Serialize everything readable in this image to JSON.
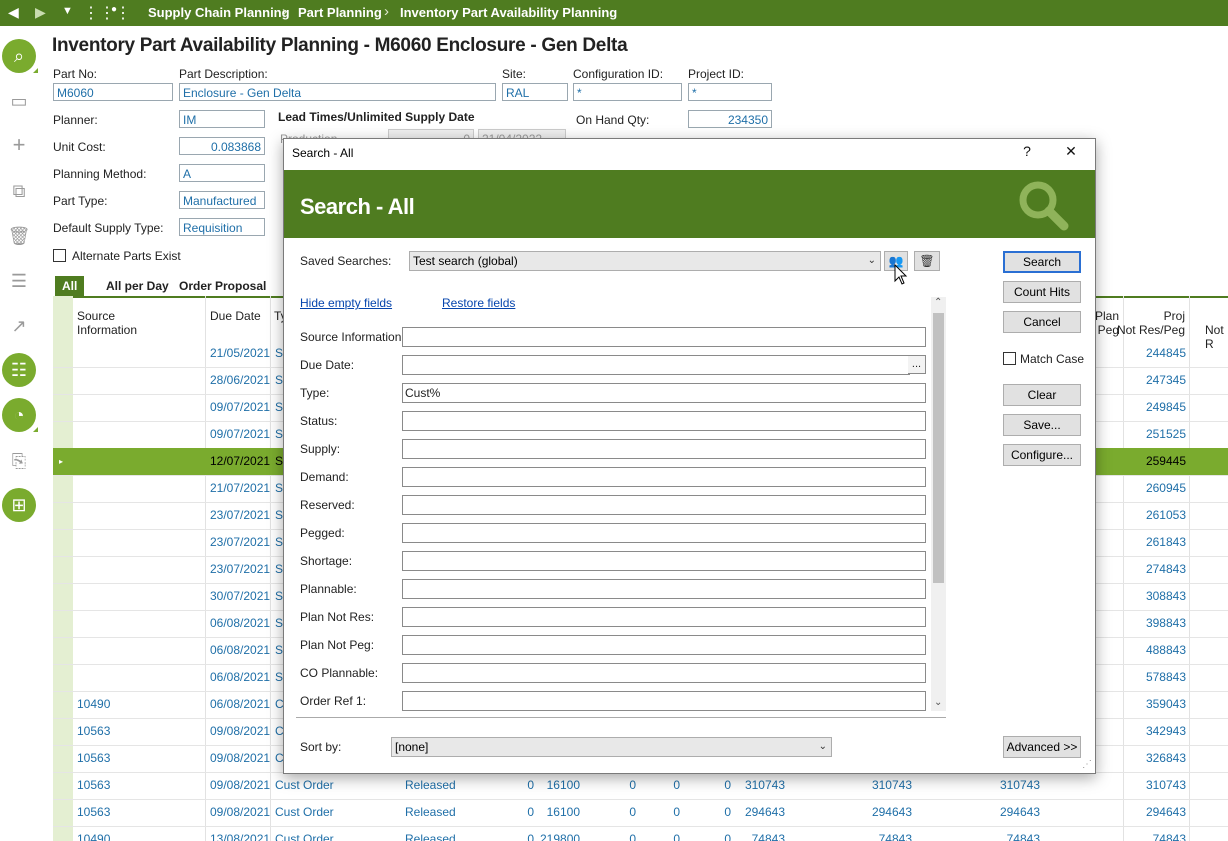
{
  "breadcrumb": {
    "items": [
      "Supply Chain Planning",
      "Part Planning",
      "Inventory Part Availability Planning"
    ]
  },
  "page": {
    "title": "Inventory Part Availability Planning - M6060 Enclosure - Gen Delta",
    "part_no_label": "Part No:",
    "part_no": "M6060",
    "part_desc_label": "Part Description:",
    "part_desc": "Enclosure - Gen Delta",
    "site_label": "Site:",
    "site": "RAL",
    "config_label": "Configuration ID:",
    "config": "*",
    "project_label": "Project ID:",
    "project": "*",
    "planner_label": "Planner:",
    "planner": "IM",
    "unit_cost_label": "Unit Cost:",
    "unit_cost": "0.083868",
    "planning_method_label": "Planning Method:",
    "planning_method": "A",
    "part_type_label": "Part Type:",
    "part_type": "Manufactured",
    "supply_type_label": "Default Supply Type:",
    "supply_type": "Requisition",
    "alt_parts_label": "Alternate Parts Exist",
    "lead_times_label": "Lead Times/Unlimited Supply Date",
    "lead_partial_label": "Production",
    "lead_partial_value": "0",
    "lead_partial_date": "21/04/2022",
    "on_hand_label": "On Hand Qty:",
    "on_hand": "234350"
  },
  "tabs": [
    "All",
    "All per Day",
    "Order Proposal"
  ],
  "grid": {
    "headers": {
      "source": "Source\nInformation",
      "due": "Due Date",
      "type": "Ty",
      "plan_not_peg": "Plan\nt Peg",
      "proj": "Proj\nNot Res/Peg",
      "not_r": "Not R"
    },
    "rows": [
      {
        "source": "",
        "due": "21/05/2021",
        "type": "S",
        "proj": "244845"
      },
      {
        "source": "",
        "due": "28/06/2021",
        "type": "S",
        "proj": "247345"
      },
      {
        "source": "",
        "due": "09/07/2021",
        "type": "S",
        "proj": "249845"
      },
      {
        "source": "",
        "due": "09/07/2021",
        "type": "S",
        "proj": "251525"
      },
      {
        "source": "",
        "due": "12/07/2021",
        "type": "S",
        "proj": "259445",
        "selected": true
      },
      {
        "source": "",
        "due": "21/07/2021",
        "type": "S",
        "proj": "260945"
      },
      {
        "source": "",
        "due": "23/07/2021",
        "type": "S",
        "proj": "261053"
      },
      {
        "source": "",
        "due": "23/07/2021",
        "type": "S",
        "proj": "261843"
      },
      {
        "source": "",
        "due": "23/07/2021",
        "type": "S",
        "proj": "274843"
      },
      {
        "source": "",
        "due": "30/07/2021",
        "type": "S",
        "proj": "308843"
      },
      {
        "source": "",
        "due": "06/08/2021",
        "type": "S",
        "proj": "398843"
      },
      {
        "source": "",
        "due": "06/08/2021",
        "type": "S",
        "proj": "488843"
      },
      {
        "source": "",
        "due": "06/08/2021",
        "type": "S",
        "proj": "578843"
      },
      {
        "source": "10490",
        "due": "06/08/2021",
        "type": "Cu",
        "proj": "359043"
      },
      {
        "source": "10563",
        "due": "09/08/2021",
        "type": "Cu",
        "proj": "342943"
      },
      {
        "source": "10563",
        "due": "09/08/2021",
        "type": "Cu",
        "proj": "326843"
      },
      {
        "source": "10563",
        "due": "09/08/2021",
        "type": "Cust Order",
        "status": "Released",
        "a": "0",
        "b": "16100",
        "c": "0",
        "d": "0",
        "e": "0",
        "f": "310743",
        "g": "310743",
        "h": "310743",
        "proj": "310743"
      },
      {
        "source": "10563",
        "due": "09/08/2021",
        "type": "Cust Order",
        "status": "Released",
        "a": "0",
        "b": "16100",
        "c": "0",
        "d": "0",
        "e": "0",
        "f": "294643",
        "g": "294643",
        "h": "294643",
        "proj": "294643"
      },
      {
        "source": "10490",
        "due": "13/08/2021",
        "type": "Cust Order",
        "status": "Released",
        "a": "0",
        "b": "219800",
        "c": "0",
        "d": "0",
        "e": "0",
        "f": "74843",
        "g": "74843",
        "h": "74843",
        "proj": "74843"
      }
    ]
  },
  "dialog": {
    "window_title": "Search - All",
    "help_label": "?",
    "close_label": "✕",
    "heading": "Search - All",
    "saved_searches_label": "Saved Searches:",
    "saved_search_value": "Test search (global)",
    "hide_empty_label": "Hide empty fields",
    "restore_label": "Restore fields",
    "fields": [
      {
        "label": "Source Information:",
        "value": ""
      },
      {
        "label": "Due Date:",
        "value": ""
      },
      {
        "label": "Type:",
        "value": "Cust%"
      },
      {
        "label": "Status:",
        "value": ""
      },
      {
        "label": "Supply:",
        "value": ""
      },
      {
        "label": "Demand:",
        "value": ""
      },
      {
        "label": "Reserved:",
        "value": ""
      },
      {
        "label": "Pegged:",
        "value": ""
      },
      {
        "label": "Shortage:",
        "value": ""
      },
      {
        "label": "Plannable:",
        "value": ""
      },
      {
        "label": "Plan Not Res:",
        "value": ""
      },
      {
        "label": "Plan Not Peg:",
        "value": ""
      },
      {
        "label": "CO Plannable:",
        "value": ""
      },
      {
        "label": "Order Ref 1:",
        "value": ""
      }
    ],
    "date_picker_label": "...",
    "sort_by_label": "Sort by:",
    "sort_by_value": "[none]",
    "buttons": {
      "search": "Search",
      "count_hits": "Count Hits",
      "cancel": "Cancel",
      "match_case": "Match Case",
      "clear": "Clear",
      "save": "Save...",
      "configure": "Configure...",
      "advanced": "Advanced >>"
    }
  }
}
